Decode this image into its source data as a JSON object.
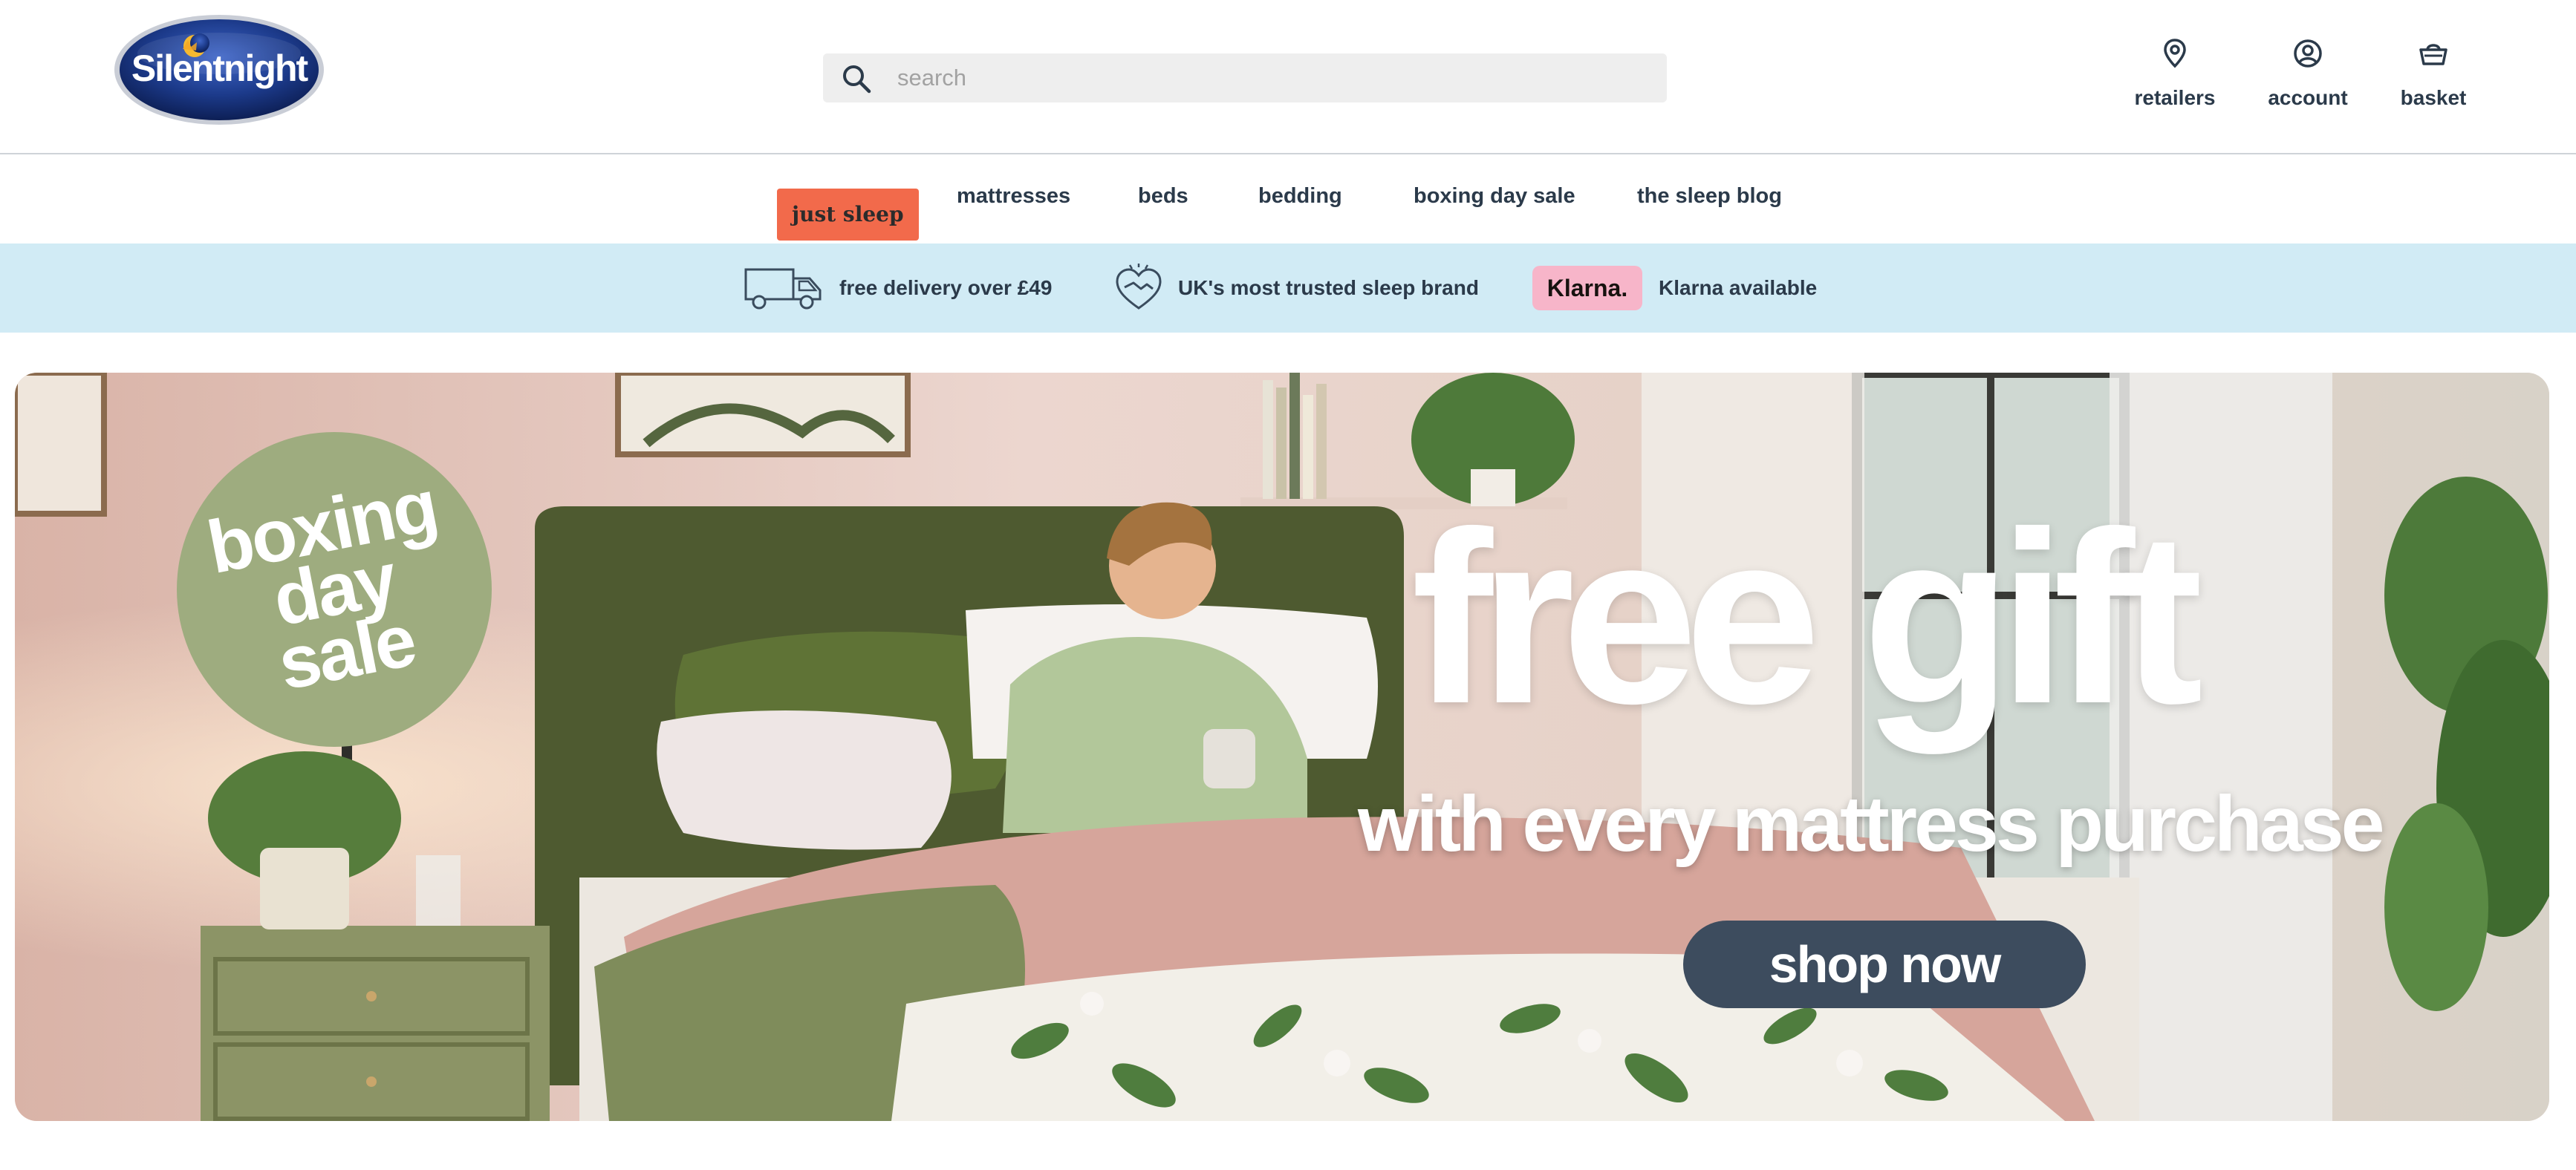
{
  "brand": {
    "name": "Silentnight",
    "logo_icon": "silentnight-moon-logo"
  },
  "search": {
    "placeholder": "search",
    "icon": "search-icon"
  },
  "header_links": [
    {
      "label": "retailers",
      "icon": "location-pin-icon"
    },
    {
      "label": "account",
      "icon": "user-circle-icon"
    },
    {
      "label": "basket",
      "icon": "basket-icon"
    }
  ],
  "nav": {
    "items": [
      {
        "label": "just sleep",
        "active": true
      },
      {
        "label": "mattresses"
      },
      {
        "label": "beds"
      },
      {
        "label": "bedding"
      },
      {
        "label": "boxing day sale"
      },
      {
        "label": "the sleep blog"
      }
    ]
  },
  "benefits": [
    {
      "label": "free delivery over £49",
      "icon": "delivery-truck-icon"
    },
    {
      "label": "UK's most trusted sleep brand",
      "icon": "handshake-heart-icon"
    },
    {
      "label": "Klarna available",
      "badge": "Klarna."
    }
  ],
  "hero": {
    "badge_lines": [
      "boxing",
      "day",
      "sale"
    ],
    "title": "free gift",
    "subtitle": "with every mattress purchase",
    "cta": "shop now"
  },
  "colors": {
    "accent": "#f26a4b",
    "benefits_bg": "#d1ebf5",
    "badge_green": "#9eac7f",
    "cta_bg": "#3d4c5e",
    "text": "#2b3a4a",
    "klarna_pink": "#f7b5c9"
  }
}
